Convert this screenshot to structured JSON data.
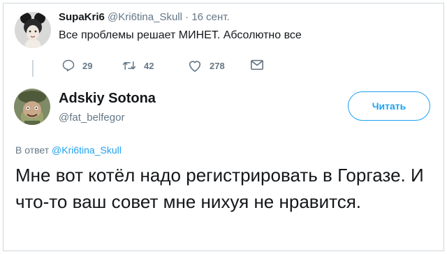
{
  "tweet1": {
    "display_name": "SupaKri6",
    "handle": "@Kri6tina_Skull",
    "separator": "·",
    "date": "16 сент.",
    "text": "Все проблемы решает МИНЕТ. Абсолютно все",
    "reply_count": "29",
    "retweet_count": "42",
    "like_count": "278",
    "icons": [
      "reply-icon",
      "retweet-icon",
      "like-icon",
      "message-icon"
    ]
  },
  "tweet2": {
    "display_name": "Adskiy Sotona",
    "handle": "@fat_belfegor",
    "follow_label": "Читать",
    "reply_prefix": "В ответ",
    "reply_to_handle": "@Kri6tina_Skull",
    "text": "Мне вот котёл надо регистрировать в Горгазе. И что-то ваш совет мне нихуя не нравится."
  },
  "colors": {
    "accent": "#1da1f2",
    "secondary_text": "#657786",
    "primary_text": "#14171a"
  }
}
